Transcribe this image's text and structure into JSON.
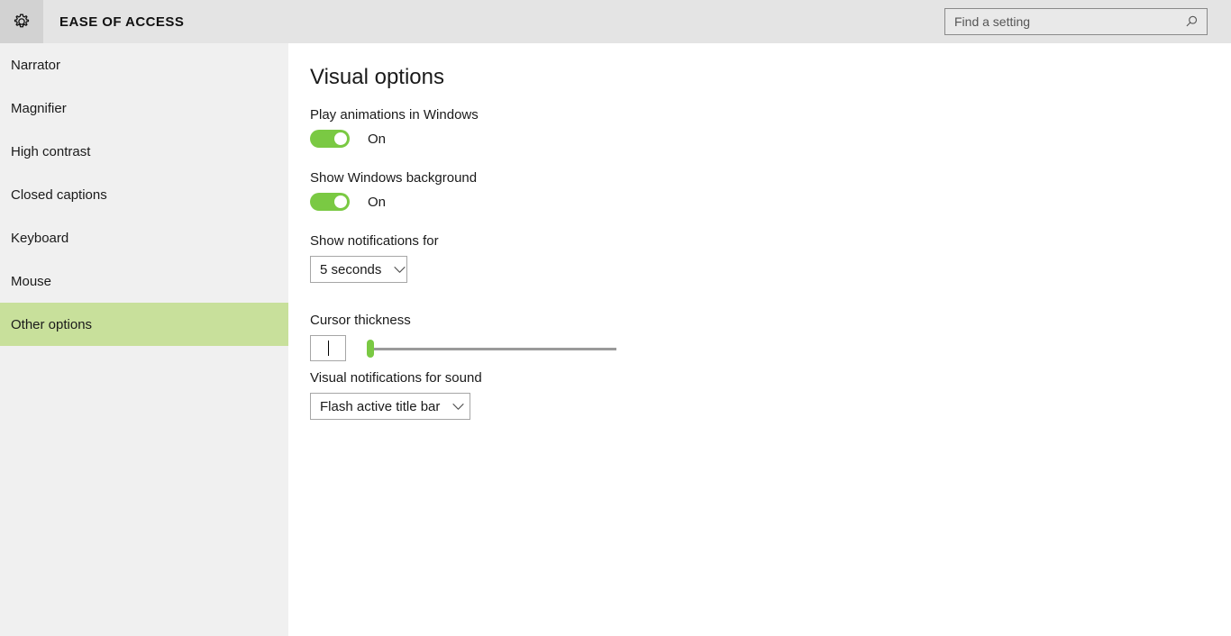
{
  "header": {
    "icon": "gear-icon",
    "title": "EASE OF ACCESS",
    "search": {
      "placeholder": "Find a setting",
      "value": "",
      "icon": "search-icon"
    }
  },
  "sidebar": {
    "items": [
      {
        "label": "Narrator",
        "selected": false
      },
      {
        "label": "Magnifier",
        "selected": false
      },
      {
        "label": "High contrast",
        "selected": false
      },
      {
        "label": "Closed captions",
        "selected": false
      },
      {
        "label": "Keyboard",
        "selected": false
      },
      {
        "label": "Mouse",
        "selected": false
      },
      {
        "label": "Other options",
        "selected": true
      }
    ],
    "selected_label": "Other options",
    "highlight_color": "#c8e09b",
    "background_color": "#f0f0f0"
  },
  "main": {
    "page_title": "Visual options",
    "settings": {
      "play_animations": {
        "label": "Play animations in Windows",
        "state": "On",
        "toggle_on": true
      },
      "show_background": {
        "label": "Show Windows background",
        "state": "On",
        "toggle_on": true
      },
      "show_notifications_for": {
        "label": "Show notifications for",
        "value": "5 seconds",
        "chevron": "chevron-down-icon"
      },
      "cursor_thickness": {
        "label": "Cursor thickness",
        "preview_caret": "text-caret-icon",
        "slider_position_percent": 0
      },
      "visual_notifications_for_sound": {
        "label": "Visual notifications for sound",
        "value": "Flash active title bar",
        "chevron": "chevron-down-icon"
      }
    }
  },
  "colors": {
    "accent_green": "#7ac943",
    "header_bar": "#e4e4e4",
    "gear_box": "#d2d2d2",
    "content_bg": "#ffffff"
  }
}
